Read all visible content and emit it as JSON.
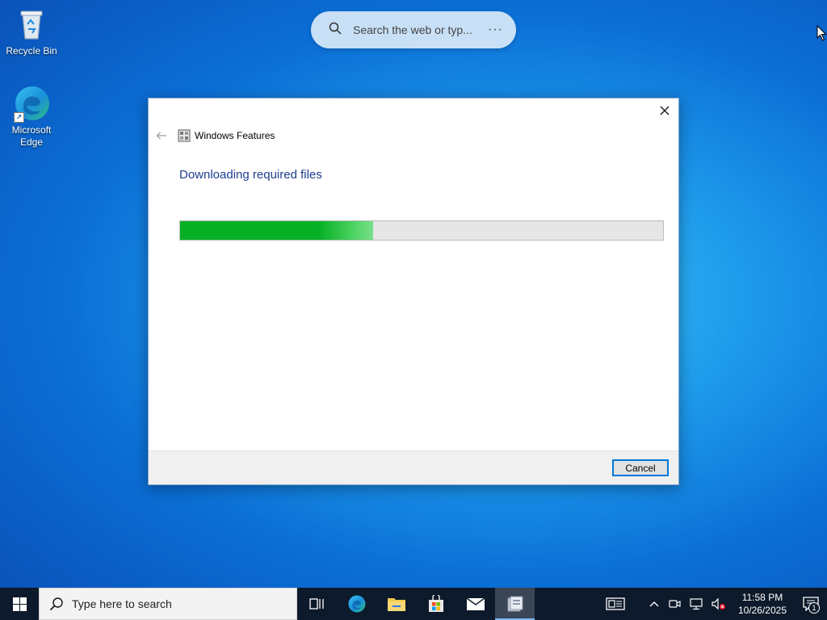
{
  "desktop": {
    "icons": [
      {
        "label": "Recycle Bin",
        "icon": "recycle-bin-icon"
      },
      {
        "label": "Microsoft Edge",
        "icon": "edge-icon"
      }
    ]
  },
  "web_search": {
    "placeholder": "Search the web or typ...",
    "icon": "search-icon",
    "more_icon": "more-options-icon"
  },
  "dialog": {
    "title": "Windows Features",
    "heading": "Downloading required files",
    "progress_fraction": 0.4,
    "progress_color": "#06b025",
    "cancel_label": "Cancel",
    "accent": "#0078d7",
    "heading_color": "#1d3d8f"
  },
  "taskbar": {
    "search_placeholder": "Type here to search",
    "apps": [
      "task-view-icon",
      "edge-icon",
      "file-explorer-icon",
      "microsoft-store-icon",
      "mail-icon",
      "windows-features-icon"
    ],
    "clock_time": "11:58 PM",
    "clock_date": "10/26/2025",
    "notification_count": "1",
    "background": "#0d1a2b"
  }
}
